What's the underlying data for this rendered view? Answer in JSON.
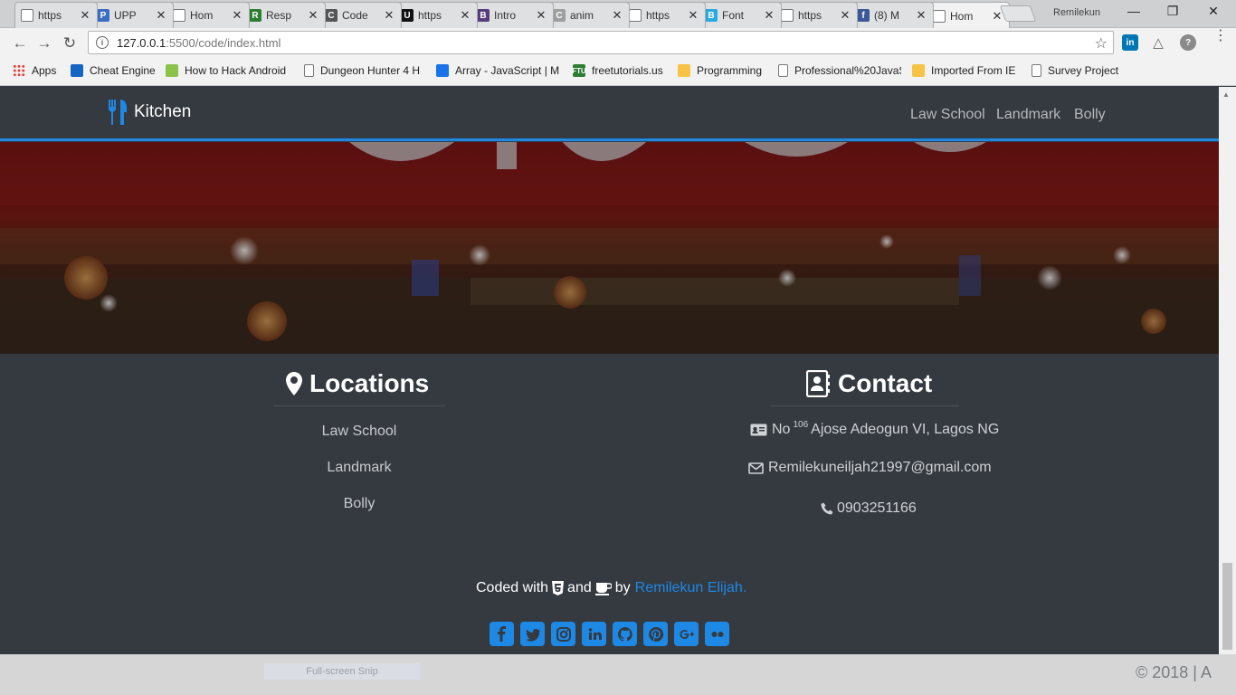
{
  "browser": {
    "tabs": [
      {
        "title": "https",
        "fav": "doc",
        "color": "#ffffff"
      },
      {
        "title": "UPP",
        "fav": "P",
        "color": "#3b6ec2"
      },
      {
        "title": "Hom",
        "fav": "doc",
        "color": "#ffffff"
      },
      {
        "title": "Resp",
        "fav": "R",
        "color": "#2e7d32"
      },
      {
        "title": "Code",
        "fav": "C",
        "color": "#555555"
      },
      {
        "title": "https",
        "fav": "U",
        "color": "#111111"
      },
      {
        "title": "Intro",
        "fav": "B",
        "color": "#563d7c"
      },
      {
        "title": "anim",
        "fav": "C",
        "color": "#9e9e9e"
      },
      {
        "title": "https",
        "fav": "doc",
        "color": "#ffffff"
      },
      {
        "title": "Font",
        "fav": "B",
        "color": "#29a9e0"
      },
      {
        "title": "https",
        "fav": "doc",
        "color": "#ffffff"
      },
      {
        "title": "(8) M",
        "fav": "f",
        "color": "#3b5998"
      },
      {
        "title": "Hom",
        "fav": "doc",
        "color": "#ffffff"
      }
    ],
    "profile_name": "Remilekun",
    "url_host": "127.0.0.1",
    "url_path": ":5500/code/index.html",
    "bookmarks": [
      {
        "label": "Apps",
        "icon": "apps-icon",
        "color": "#e53935"
      },
      {
        "label": "Cheat Engine",
        "icon": "cheat-engine-icon",
        "color": "#1565c0"
      },
      {
        "label": "How to Hack Android",
        "icon": "android-icon",
        "color": "#8bc34a"
      },
      {
        "label": "Dungeon Hunter 4 H",
        "icon": "page-icon",
        "color": "#ffffff"
      },
      {
        "label": "Array - JavaScript | M",
        "icon": "mdn-icon",
        "color": "#1a73e8"
      },
      {
        "label": "freetutorials.us",
        "icon": "ftu-icon",
        "color": "#2e7d32"
      },
      {
        "label": "Programming",
        "icon": "folder-icon",
        "color": "#f6c344"
      },
      {
        "label": "Professional%20JavaS",
        "icon": "page-icon",
        "color": "#ffffff"
      },
      {
        "label": "Imported From IE",
        "icon": "folder-icon",
        "color": "#f6c344"
      },
      {
        "label": "Survey Project",
        "icon": "page-icon",
        "color": "#ffffff"
      }
    ]
  },
  "site": {
    "brand": "Kitchen",
    "nav": [
      "Law School",
      "Landmark",
      "Bolly"
    ],
    "locations": {
      "title": "Locations",
      "items": [
        "Law School",
        "Landmark",
        "Bolly"
      ]
    },
    "contact": {
      "title": "Contact",
      "address_prefix": "No",
      "address_number": "106",
      "address_rest": "Ajose Adeogun VI, Lagos NG",
      "email": "Remilekuneiljah21997@gmail.com",
      "phone": "0903251166"
    },
    "credit": {
      "coded_with": "Coded with",
      "and": "and",
      "by": "by",
      "author": "Remilekun Elijah."
    },
    "socials": [
      "facebook-icon",
      "twitter-icon",
      "instagram-icon",
      "linkedin-icon",
      "github-icon",
      "pinterest-icon",
      "google-plus-icon",
      "flickr-icon"
    ],
    "accent": "#1e88e5"
  },
  "overlay": {
    "snip_label": "Full-screen Snip",
    "copyright": "© 2018 | A"
  }
}
